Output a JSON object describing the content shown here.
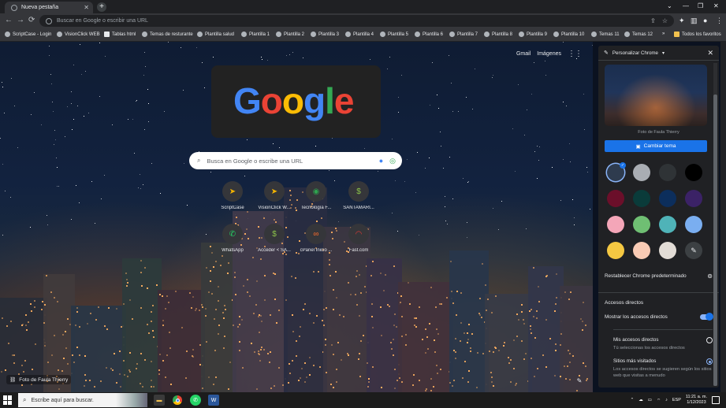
{
  "tab": {
    "title": "Nueva pestaña",
    "close": "✕",
    "new_tab": "+"
  },
  "window_controls": {
    "minimize": "—",
    "restore": "❐",
    "close": "✕",
    "dropdown": "⌄"
  },
  "toolbar": {
    "back": "←",
    "forward": "→",
    "reload": "⟳",
    "omnibox_placeholder": "Buscar en Google o escribir una URL"
  },
  "bookmarks": {
    "items": [
      {
        "label": "ScriptCase - Login"
      },
      {
        "label": "VisionClick WEB"
      },
      {
        "label": "Tablas html"
      },
      {
        "label": "Temas de resturante"
      },
      {
        "label": "Plantilla salud"
      },
      {
        "label": "Plantilla 1"
      },
      {
        "label": "Plantilla 2"
      },
      {
        "label": "Plantilla 3"
      },
      {
        "label": "Plantilla 4"
      },
      {
        "label": "Plantilla 5"
      },
      {
        "label": "Plantilla 6"
      },
      {
        "label": "Plantilla 7"
      },
      {
        "label": "Plantilla 8"
      },
      {
        "label": "Plantilla 9"
      },
      {
        "label": "Plantilla 10"
      },
      {
        "label": "Temas 11"
      },
      {
        "label": "Temas 12"
      }
    ],
    "more": "»",
    "all_label": "Todos los favoritos"
  },
  "ntp": {
    "gmail": "Gmail",
    "images": "Imágenes",
    "doodle_text": "Google",
    "search_placeholder": "Busca en Google o escribe una URL",
    "shortcuts": [
      {
        "label": "ScriptCase",
        "icon": "scriptcase-icon"
      },
      {
        "label": "VisionClick W...",
        "icon": "visionclick-icon"
      },
      {
        "label": "Tecnología F...",
        "icon": "tecnologia-icon"
      },
      {
        "label": "SANTAMARI...",
        "icon": "santamaria-icon"
      },
      {
        "label": "WhatsApp",
        "icon": "whatsapp-icon"
      },
      {
        "label": "Acceder < SA...",
        "icon": "acceder-icon"
      },
      {
        "label": "cPanel Inicio ...",
        "icon": "cpanel-icon"
      },
      {
        "label": "Fast.com",
        "icon": "fast-icon"
      }
    ],
    "photo_credit": "Foto de Faula Thierry"
  },
  "panel": {
    "title": "Personalizar Chrome",
    "theme_author": "Foto de Faula Thierry",
    "change_theme": "Cambiar tema",
    "colors": [
      "#2e3b4e",
      "#a9adb3",
      "#2f3336",
      "#000000",
      "#6b0f2a",
      "#0a3b3a",
      "#0c2e5c",
      "#3b2266",
      "#f4a6b8",
      "#6fbf73",
      "#4fb3b8",
      "#7aaef0",
      "#f5c842",
      "#f9cbb5",
      "#e2dcd6",
      "#3c4043"
    ],
    "restore": "Restablecer Chrome predeterminado",
    "shortcuts_title": "Accesos directos",
    "show_shortcuts": "Mostrar los accesos directos",
    "show_shortcuts_on": true,
    "my_shortcuts": "Mis accesos directos",
    "my_shortcuts_desc": "Tú seleccionas los accesos directos",
    "most_visited": "Sitios más visitados",
    "most_visited_desc": "Los accesos directos se sugieren según los sitios web que visitas a menudo"
  },
  "taskbar": {
    "search_placeholder": "Escribe aquí para buscar.",
    "lang": "ESP",
    "time": "11:21 a. m.",
    "date": "1/12/2023"
  }
}
